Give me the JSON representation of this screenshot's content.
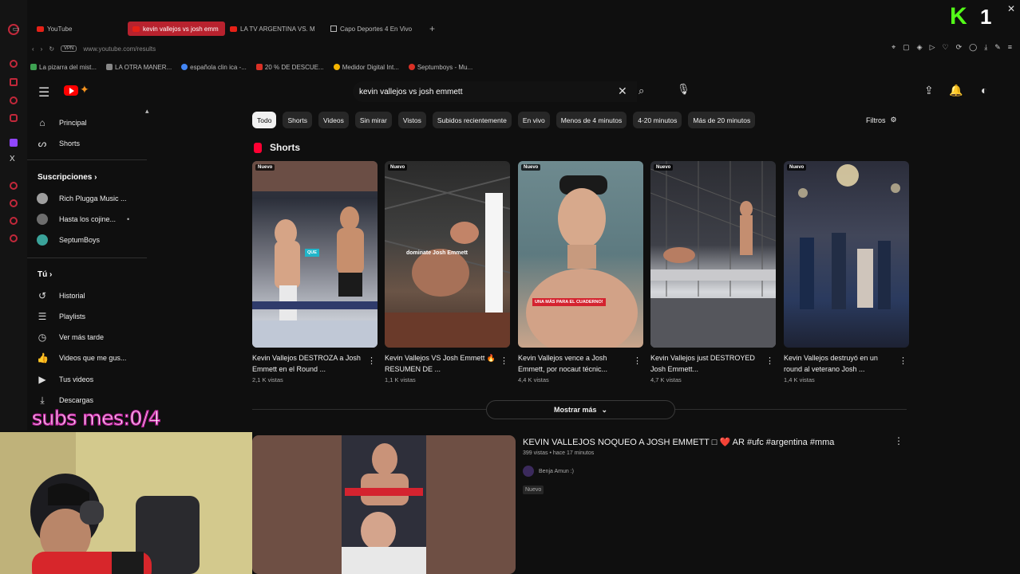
{
  "browser": {
    "tabs": [
      {
        "label": "YouTube",
        "active": false,
        "icon": "youtube-icon"
      },
      {
        "label": "kevin vallejos vs josh emm",
        "active": true,
        "icon": "youtube-icon"
      },
      {
        "label": "LA TV ARGENTINA VS. M",
        "active": false,
        "icon": "youtube-icon"
      },
      {
        "label": "Capo Deportes 4 En Vivo",
        "active": false,
        "icon": "page-icon"
      }
    ],
    "vpn_label": "VPN",
    "url": "www.youtube.com/results",
    "bookmarks": [
      {
        "label": "La pizarra del mist...",
        "color": "#3ea152"
      },
      {
        "label": "LA OTRA MANER...",
        "color": "#888888"
      },
      {
        "label": "española clin ica -...",
        "color": "#4285f4"
      },
      {
        "label": "20 % DE DESCUE...",
        "color": "#d93025"
      },
      {
        "label": "Medidor Digital Int...",
        "color": "#f4b400"
      },
      {
        "label": "Septumboys - Mu...",
        "color": "#d93025"
      }
    ]
  },
  "overlay": {
    "kick_logo": "K",
    "kick_count": "1",
    "subs_text": "subs mes:0/4"
  },
  "header": {
    "search_value": "kevin vallejos vs josh emmett"
  },
  "sidebar": {
    "main": [
      {
        "label": "Principal",
        "icon": "home-icon"
      },
      {
        "label": "Shorts",
        "icon": "shorts-icon"
      }
    ],
    "subscriptions_heading": "Suscripciones",
    "subscriptions": [
      {
        "label": "Rich Plugga Music ...",
        "color": "#9e9e9e"
      },
      {
        "label": "Hasta los cojine...",
        "color": "#6d6d6d",
        "dot": "•"
      },
      {
        "label": "SeptumBoys",
        "color": "#3aa39a"
      }
    ],
    "you_heading": "Tú",
    "you": [
      {
        "label": "Historial",
        "icon": "history-icon"
      },
      {
        "label": "Playlists",
        "icon": "playlists-icon"
      },
      {
        "label": "Ver más tarde",
        "icon": "clock-icon"
      },
      {
        "label": "Videos que me gus...",
        "icon": "thumbs-up-icon"
      },
      {
        "label": "Tus videos",
        "icon": "video-icon"
      },
      {
        "label": "Descargas",
        "icon": "download-icon"
      }
    ]
  },
  "chips": [
    "Todo",
    "Shorts",
    "Videos",
    "Sin mirar",
    "Vistos",
    "Subidos recientemente",
    "En vivo",
    "Menos de 4 minutos",
    "4-20 minutos",
    "Más de 20 minutos"
  ],
  "filters_label": "Filtros",
  "shorts": {
    "heading": "Shorts",
    "items": [
      {
        "badge": "Nuevo",
        "title": "Kevin Vallejos DESTROZA a Josh Emmett en el Round ...",
        "views": "2,1 K vistas",
        "caption": "QUE"
      },
      {
        "badge": "Nuevo",
        "title": "Kevin Vallejos VS Josh Emmett 🔥 RESUMEN DE ...",
        "views": "1,1 K vistas",
        "caption": "dominate Josh Emmett"
      },
      {
        "badge": "Nuevo",
        "title": "Kevin Vallejos vence a Josh Emmett, por nocaut técnic...",
        "views": "4,4 K vistas",
        "caption": "UNA MÁS PARA EL CUADERNO!"
      },
      {
        "badge": "Nuevo",
        "title": "Kevin Vallejos just DESTROYED Josh Emmett...",
        "views": "4,7 K vistas",
        "caption": ""
      },
      {
        "badge": "Nuevo",
        "title": "Kevin Vallejos destruyó en un round al veterano Josh ...",
        "views": "1,4 K vistas",
        "caption": ""
      }
    ],
    "show_more": "Mostrar más"
  },
  "video": {
    "title": "KEVIN VALLEJOS NOQUEO A JOSH EMMETT □ ❤️ AR #ufc #argentina #mma",
    "meta": "399 vistas • hace 17 minutos",
    "channel": "Benja Amun :)",
    "badge": "Nuevo"
  }
}
